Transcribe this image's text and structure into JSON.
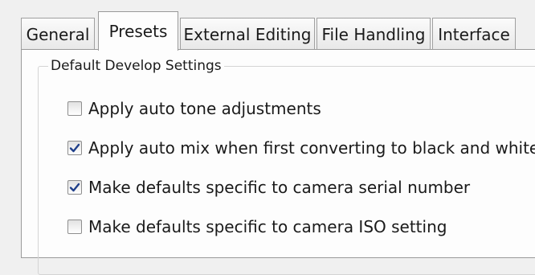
{
  "tabs": [
    {
      "label": "General",
      "active": false
    },
    {
      "label": "Presets",
      "active": true
    },
    {
      "label": "External Editing",
      "active": false
    },
    {
      "label": "File Handling",
      "active": false
    },
    {
      "label": "Interface",
      "active": false
    }
  ],
  "group": {
    "title": "Default Develop Settings",
    "options": [
      {
        "label": "Apply auto tone adjustments",
        "checked": false
      },
      {
        "label": "Apply auto mix when first converting to black and white",
        "checked": true
      },
      {
        "label": "Make defaults specific to camera serial number",
        "checked": true
      },
      {
        "label": "Make defaults specific to camera ISO setting",
        "checked": false
      }
    ]
  },
  "colors": {
    "check_mark": "#1f3f8a",
    "tab_border": "#9a9a9a",
    "panel_bg": "#fdfdfd"
  }
}
